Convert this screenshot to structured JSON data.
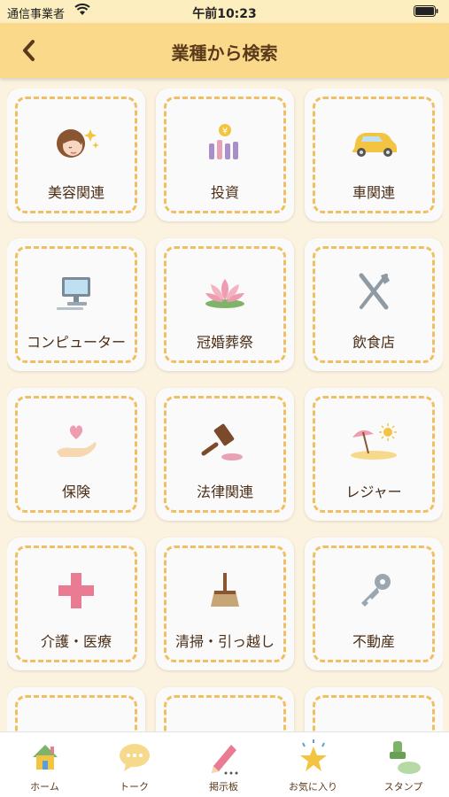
{
  "status_bar": {
    "carrier": "通信事業者",
    "time": "午前10:23"
  },
  "header": {
    "title": "業種から検索"
  },
  "categories": [
    {
      "label": "美容関連",
      "icon": "beauty-woman-icon"
    },
    {
      "label": "投資",
      "icon": "investment-chart-icon"
    },
    {
      "label": "車関連",
      "icon": "car-icon"
    },
    {
      "label": "コンピューター",
      "icon": "computer-icon"
    },
    {
      "label": "冠婚葬祭",
      "icon": "lotus-icon"
    },
    {
      "label": "飲食店",
      "icon": "fork-knife-icon"
    },
    {
      "label": "保険",
      "icon": "heart-hand-icon"
    },
    {
      "label": "法律関連",
      "icon": "gavel-icon"
    },
    {
      "label": "レジャー",
      "icon": "beach-umbrella-icon"
    },
    {
      "label": "介護・医療",
      "icon": "medical-cross-icon"
    },
    {
      "label": "清掃・引っ越し",
      "icon": "broom-icon"
    },
    {
      "label": "不動産",
      "icon": "key-icon"
    }
  ],
  "tabbar": {
    "home": "ホーム",
    "talk": "トーク",
    "board": "掲示板",
    "favorites": "お気に入り",
    "stamp": "スタンプ"
  },
  "colors": {
    "header": "#fad98a",
    "background": "#fbf3df",
    "dash": "#f0bf62",
    "text": "#4a2d16"
  }
}
